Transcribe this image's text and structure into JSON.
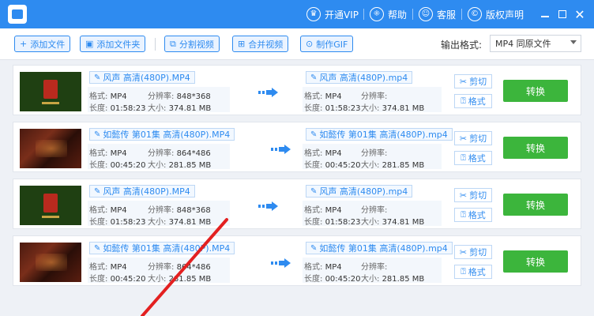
{
  "titlebar": {
    "links": [
      {
        "label": "开通VIP",
        "icon": "vip-icon"
      },
      {
        "label": "帮助",
        "icon": "help-icon"
      },
      {
        "label": "客服",
        "icon": "customer-service-icon"
      },
      {
        "label": "版权声明",
        "icon": "copyright-icon"
      }
    ]
  },
  "toolbar": {
    "buttons": [
      {
        "label": "添加文件",
        "icon": "+"
      },
      {
        "label": "添加文件夹",
        "icon": "▣"
      },
      {
        "label": "分割视频",
        "icon": "⧉"
      },
      {
        "label": "合并视频",
        "icon": "⊞"
      },
      {
        "label": "制作GIF",
        "icon": "⊙"
      }
    ],
    "format_label": "输出格式:",
    "format_value": "MP4  同原文件"
  },
  "labels": {
    "format": "格式:",
    "resolution": "分辨率:",
    "duration": "长度:",
    "size": "大小:",
    "cut": "剪切",
    "format_btn": "格式",
    "convert": "转换"
  },
  "files": [
    {
      "thumb": "fengsheng",
      "src_name": "风声 高清(480P).MP4",
      "dst_name": "风声 高清(480P).mp4",
      "format": "MP4",
      "resolution": "848*368",
      "duration": "01:58:23",
      "size": "374.81 MB",
      "dst_format": "MP4",
      "dst_resolution": "",
      "dst_duration": "01:58:23",
      "dst_size": "374.81 MB"
    },
    {
      "thumb": "rulan",
      "src_name": "如懿传 第01集 高清(480P).MP4",
      "dst_name": "如懿传 第01集 高清(480P).mp4",
      "format": "MP4",
      "resolution": "864*486",
      "duration": "00:45:20",
      "size": "281.85 MB",
      "dst_format": "MP4",
      "dst_resolution": "",
      "dst_duration": "00:45:20",
      "dst_size": "281.85 MB"
    },
    {
      "thumb": "fengsheng",
      "src_name": "风声 高清(480P).MP4",
      "dst_name": "风声 高清(480P).mp4",
      "format": "MP4",
      "resolution": "848*368",
      "duration": "01:58:23",
      "size": "374.81 MB",
      "dst_format": "MP4",
      "dst_resolution": "",
      "dst_duration": "01:58:23",
      "dst_size": "374.81 MB"
    },
    {
      "thumb": "rulan",
      "src_name": "如懿传 第01集 高清(480P).MP4",
      "dst_name": "如懿传 第01集 高清(480P).mp4",
      "format": "MP4",
      "resolution": "864*486",
      "duration": "00:45:20",
      "size": "281.85 MB",
      "dst_format": "MP4",
      "dst_resolution": "",
      "dst_duration": "00:45:20",
      "dst_size": "281.85 MB"
    }
  ],
  "colors": {
    "accent": "#2e8bf0",
    "convert": "#3cb53c",
    "annotation": "#e32020"
  }
}
